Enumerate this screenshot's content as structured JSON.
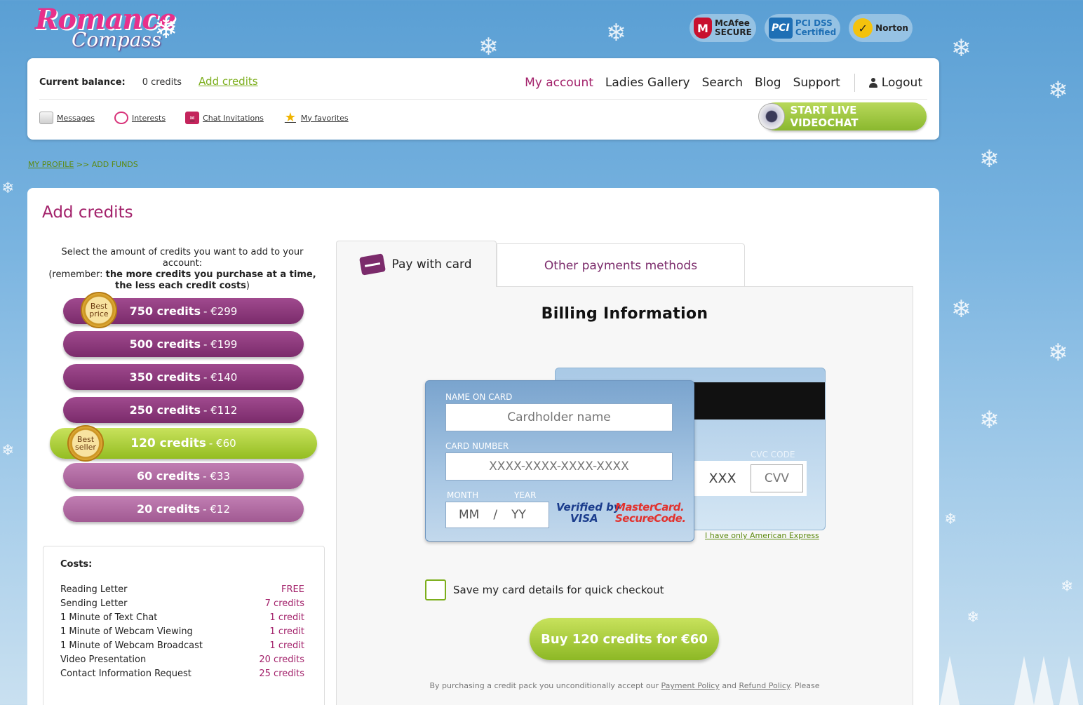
{
  "logo": {
    "line1": "Romance",
    "line2": "Compass"
  },
  "badges": [
    {
      "icon": "mcafee-shield-icon",
      "text1": "McAfee",
      "text2": "SECURE"
    },
    {
      "icon": "pci-dss-icon",
      "text1": "PCI DSS",
      "text2": "Certified"
    },
    {
      "icon": "norton-check-icon",
      "text1": "Norton",
      "text2": ""
    }
  ],
  "header": {
    "balance_label": "Current balance:",
    "balance_value": "0 credits",
    "add_credits": "Add credits",
    "nav": {
      "my_account": "My account",
      "ladies_gallery": "Ladies Gallery",
      "search": "Search",
      "blog": "Blog",
      "support": "Support",
      "logout": "Logout"
    },
    "subnav": {
      "messages": "Messages",
      "interests": "Interests",
      "chat_invitations": "Chat Invitations",
      "my_favorites": "My favorites"
    },
    "live_videochat": "START LIVE VIDEOCHAT"
  },
  "breadcrumb": {
    "profile": "MY PROFILE",
    "sep": ">>",
    "current": "ADD FUNDS"
  },
  "main": {
    "title": "Add credits",
    "intro_line1": "Select the amount of credits you want to add to your account:",
    "intro_pre": "(remember: ",
    "intro_bold": "the more credits you purchase at a time, the less each credit costs",
    "intro_post": ")"
  },
  "packages": [
    {
      "credits": "750 credits",
      "price": "- €299",
      "seal": "Best price"
    },
    {
      "credits": "500 credits",
      "price": "- €199"
    },
    {
      "credits": "350 credits",
      "price": "- €140"
    },
    {
      "credits": "250 credits",
      "price": "- €112"
    },
    {
      "credits": "120 credits",
      "price": "- €60",
      "seal": "Best seller",
      "selected": true
    },
    {
      "credits": "60 credits",
      "price": "- €33"
    },
    {
      "credits": "20 credits",
      "price": "- €12"
    }
  ],
  "costs": {
    "title": "Costs:",
    "rows": [
      {
        "item": "Reading Letter",
        "cost": "FREE"
      },
      {
        "item": "Sending Letter",
        "cost": "7 credits"
      },
      {
        "item": "1 Minute of Text Chat",
        "cost": "1 credit"
      },
      {
        "item": "1 Minute of Webcam Viewing",
        "cost": "1 credit"
      },
      {
        "item": "1 Minute of Webcam Broadcast",
        "cost": "1 credit"
      },
      {
        "item": "Video Presentation",
        "cost": "20 credits"
      },
      {
        "item": "Contact Information Request",
        "cost": "25 credits"
      }
    ]
  },
  "tabs": {
    "pay_with_card": "Pay with card",
    "other_methods": "Other payments methods"
  },
  "billing": {
    "title": "Billing Information",
    "name_label": "NAME ON CARD",
    "name_placeholder": "Cardholder name",
    "number_label": "CARD NUMBER",
    "number_placeholder": "XXXX-XXXX-XXXX-XXXX",
    "month_label": "MONTH",
    "year_label": "YEAR",
    "month_placeholder": "MM",
    "slash": "/",
    "year_placeholder": "YY",
    "cvc_label": "CVC CODE",
    "cvc_mask": "XXX",
    "cvv_placeholder": "CVV",
    "verified_by": "Verified by",
    "visa": "VISA",
    "mastercard": "MasterCard.",
    "securecode": "SecureCode.",
    "amex_link": "I have only American Express",
    "save_card": "Save my card details for quick checkout",
    "buy_button": "Buy 120 credits for €60",
    "terms_pre": "By purchasing a credit pack you unconditionally accept our ",
    "payment_policy": "Payment Policy",
    "terms_and": " and ",
    "refund_policy": "Refund Policy",
    "terms_post": ". Please"
  }
}
